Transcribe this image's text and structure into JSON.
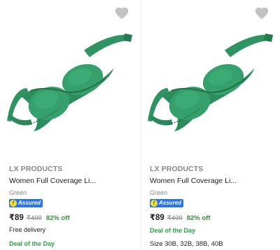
{
  "colors": {
    "accent_blue": "#2874f0",
    "offer_green": "#388e3c",
    "deal_green": "#26a541",
    "product_green": "#2f9462"
  },
  "products": [
    {
      "brand": "LX PRODUCTS",
      "title": "Women Full Coverage Li...",
      "color": "Green",
      "assured_label": "Assured",
      "price": "₹89",
      "mrp": "₹499",
      "discount": "82% off",
      "delivery": "Free delivery",
      "deal": "Deal of the Day",
      "wishlist_icon": "heart-icon"
    },
    {
      "brand": "LX PRODUCTS",
      "title": "Women Full Coverage Li...",
      "color": "Green",
      "assured_label": "Assured",
      "price": "₹89",
      "mrp": "₹499",
      "discount": "82% off",
      "deal": "Deal of the Day",
      "sizes": "Size 30B, 32B, 38B, 40B",
      "wishlist_icon": "heart-icon"
    }
  ]
}
